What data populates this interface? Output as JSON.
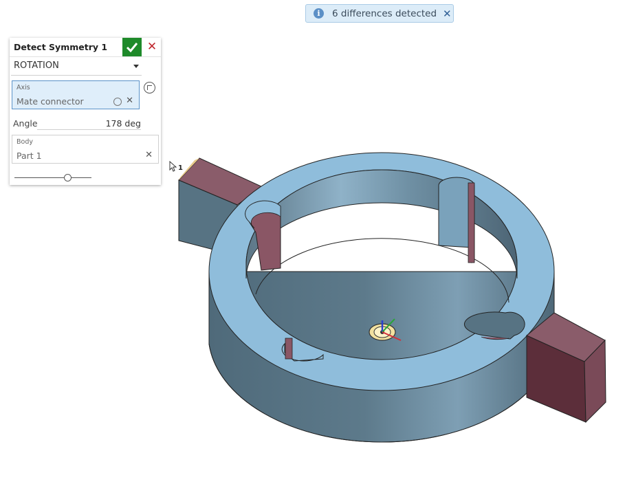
{
  "notification": {
    "message": "6 differences detected",
    "info_glyph": "i",
    "close_glyph": "✕"
  },
  "panel": {
    "title": "Detect Symmetry 1",
    "ok_icon": "checkmark-icon",
    "cancel_glyph": "✕",
    "mode": "ROTATION",
    "axis": {
      "label": "Axis",
      "value": "Mate connector",
      "clear_glyph": "✕"
    },
    "angle": {
      "label": "Angle",
      "value": "178 deg"
    },
    "body": {
      "label": "Body",
      "value": "Part 1",
      "clear_glyph": "✕"
    },
    "slider_level": 0.69
  },
  "cursor_badge": "1",
  "colors": {
    "part_top": "#8fbddb",
    "part_side": "#577383",
    "difference": "#8a5665",
    "accent_green": "#1e8a2a",
    "cancel_red": "#c0262d"
  }
}
